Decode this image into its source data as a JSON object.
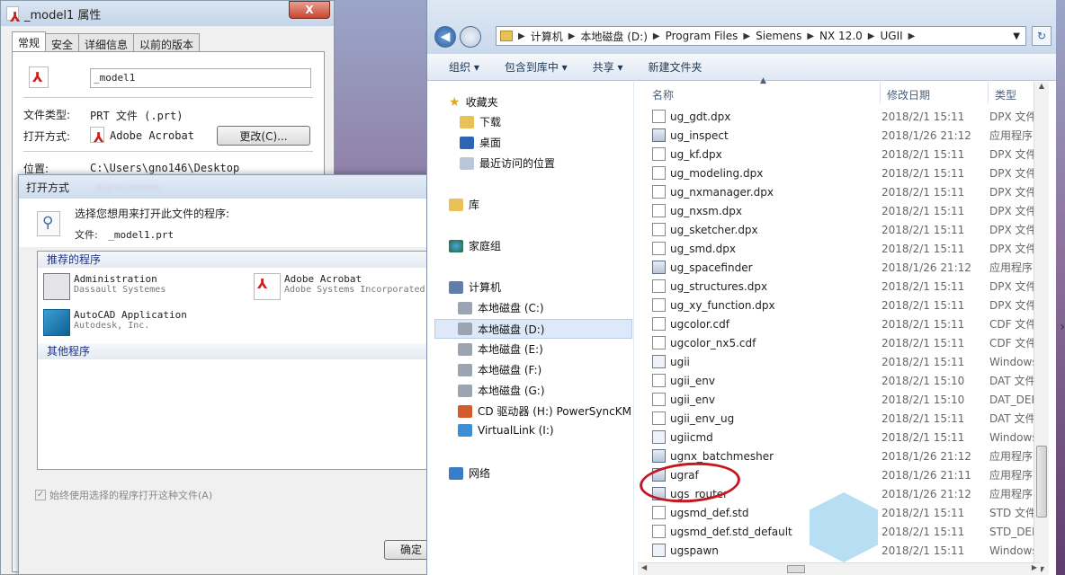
{
  "props": {
    "title": "_model1 属性",
    "close": "X",
    "tabs": [
      "常规",
      "安全",
      "详细信息",
      "以前的版本"
    ],
    "filename": "_model1",
    "type_label": "文件类型:",
    "type_value": "PRT 文件 (.prt)",
    "openwith_label": "打开方式:",
    "openwith_value": "Adobe Acrobat",
    "change_button": "更改(C)...",
    "location_label": "位置:",
    "location_value": "C:\\Users\\gno146\\Desktop"
  },
  "openwith": {
    "title": "打开方式",
    "prompt": "选择您想用来打开此文件的程序:",
    "file_label": "文件:",
    "file_value": "_model1.prt",
    "recommended_header": "推荐的程序",
    "programs": [
      {
        "name": "Administration",
        "vendor": "Dassault Systemes"
      },
      {
        "name": "Adobe Acrobat",
        "vendor": "Adobe Systems Incorporated"
      },
      {
        "name": "AutoCAD Application",
        "vendor": "Autodesk, Inc."
      }
    ],
    "other_header": "其他程序",
    "always_use": "始终使用选择的程序打开这种文件(A)",
    "ok_button": "确定"
  },
  "explorer": {
    "breadcrumb": [
      "计算机",
      "本地磁盘 (D:)",
      "Program Files",
      "Siemens",
      "NX 12.0",
      "UGII"
    ],
    "toolbar": [
      "组织 ▾",
      "包含到库中 ▾",
      "共享 ▾",
      "新建文件夹"
    ],
    "nav": {
      "favorites": "收藏夹",
      "downloads": "下载",
      "desktop": "桌面",
      "recent": "最近访问的位置",
      "library": "库",
      "homegroup": "家庭组",
      "computer": "计算机",
      "drives": [
        "本地磁盘 (C:)",
        "本地磁盘 (D:)",
        "本地磁盘 (E:)",
        "本地磁盘 (F:)",
        "本地磁盘 (G:)",
        "CD 驱动器 (H:) PowerSyncKM",
        "VirtualLink (I:)"
      ],
      "network": "网络"
    },
    "columns": {
      "name": "名称",
      "date": "修改日期",
      "type": "类型"
    },
    "files": [
      {
        "name": "ug_gdt.dpx",
        "date": "2018/2/1 15:11",
        "type": "DPX 文件",
        "icon": "doc"
      },
      {
        "name": "ug_inspect",
        "date": "2018/1/26 21:12",
        "type": "应用程序",
        "icon": "exe"
      },
      {
        "name": "ug_kf.dpx",
        "date": "2018/2/1 15:11",
        "type": "DPX 文件",
        "icon": "doc"
      },
      {
        "name": "ug_modeling.dpx",
        "date": "2018/2/1 15:11",
        "type": "DPX 文件",
        "icon": "doc"
      },
      {
        "name": "ug_nxmanager.dpx",
        "date": "2018/2/1 15:11",
        "type": "DPX 文件",
        "icon": "doc"
      },
      {
        "name": "ug_nxsm.dpx",
        "date": "2018/2/1 15:11",
        "type": "DPX 文件",
        "icon": "doc"
      },
      {
        "name": "ug_sketcher.dpx",
        "date": "2018/2/1 15:11",
        "type": "DPX 文件",
        "icon": "doc"
      },
      {
        "name": "ug_smd.dpx",
        "date": "2018/2/1 15:11",
        "type": "DPX 文件",
        "icon": "doc"
      },
      {
        "name": "ug_spacefinder",
        "date": "2018/1/26 21:12",
        "type": "应用程序",
        "icon": "exe"
      },
      {
        "name": "ug_structures.dpx",
        "date": "2018/2/1 15:11",
        "type": "DPX 文件",
        "icon": "doc"
      },
      {
        "name": "ug_xy_function.dpx",
        "date": "2018/2/1 15:11",
        "type": "DPX 文件",
        "icon": "doc"
      },
      {
        "name": "ugcolor.cdf",
        "date": "2018/2/1 15:11",
        "type": "CDF 文件",
        "icon": "doc"
      },
      {
        "name": "ugcolor_nx5.cdf",
        "date": "2018/2/1 15:11",
        "type": "CDF 文件",
        "icon": "doc"
      },
      {
        "name": "ugii",
        "date": "2018/2/1 15:11",
        "type": "Windows",
        "icon": "win"
      },
      {
        "name": "ugii_env",
        "date": "2018/2/1 15:10",
        "type": "DAT 文件",
        "icon": "doc"
      },
      {
        "name": "ugii_env",
        "date": "2018/2/1 15:10",
        "type": "DAT_DEFA",
        "icon": "doc"
      },
      {
        "name": "ugii_env_ug",
        "date": "2018/2/1 15:11",
        "type": "DAT 文件",
        "icon": "doc"
      },
      {
        "name": "ugiicmd",
        "date": "2018/2/1 15:11",
        "type": "Windows",
        "icon": "win"
      },
      {
        "name": "ugnx_batchmesher",
        "date": "2018/1/26 21:12",
        "type": "应用程序",
        "icon": "exe"
      },
      {
        "name": "ugraf",
        "date": "2018/1/26 21:11",
        "type": "应用程序",
        "icon": "exe"
      },
      {
        "name": "ugs_router",
        "date": "2018/1/26 21:12",
        "type": "应用程序",
        "icon": "exe"
      },
      {
        "name": "ugsmd_def.std",
        "date": "2018/2/1 15:11",
        "type": "STD 文件",
        "icon": "doc"
      },
      {
        "name": "ugsmd_def.std_default",
        "date": "2018/2/1 15:11",
        "type": "STD_DEF",
        "icon": "doc"
      },
      {
        "name": "ugspawn",
        "date": "2018/2/1 15:11",
        "type": "Windows",
        "icon": "win"
      }
    ],
    "colors": {
      "highlight_circle": "#c41820",
      "selection": "#dde9f8"
    }
  }
}
